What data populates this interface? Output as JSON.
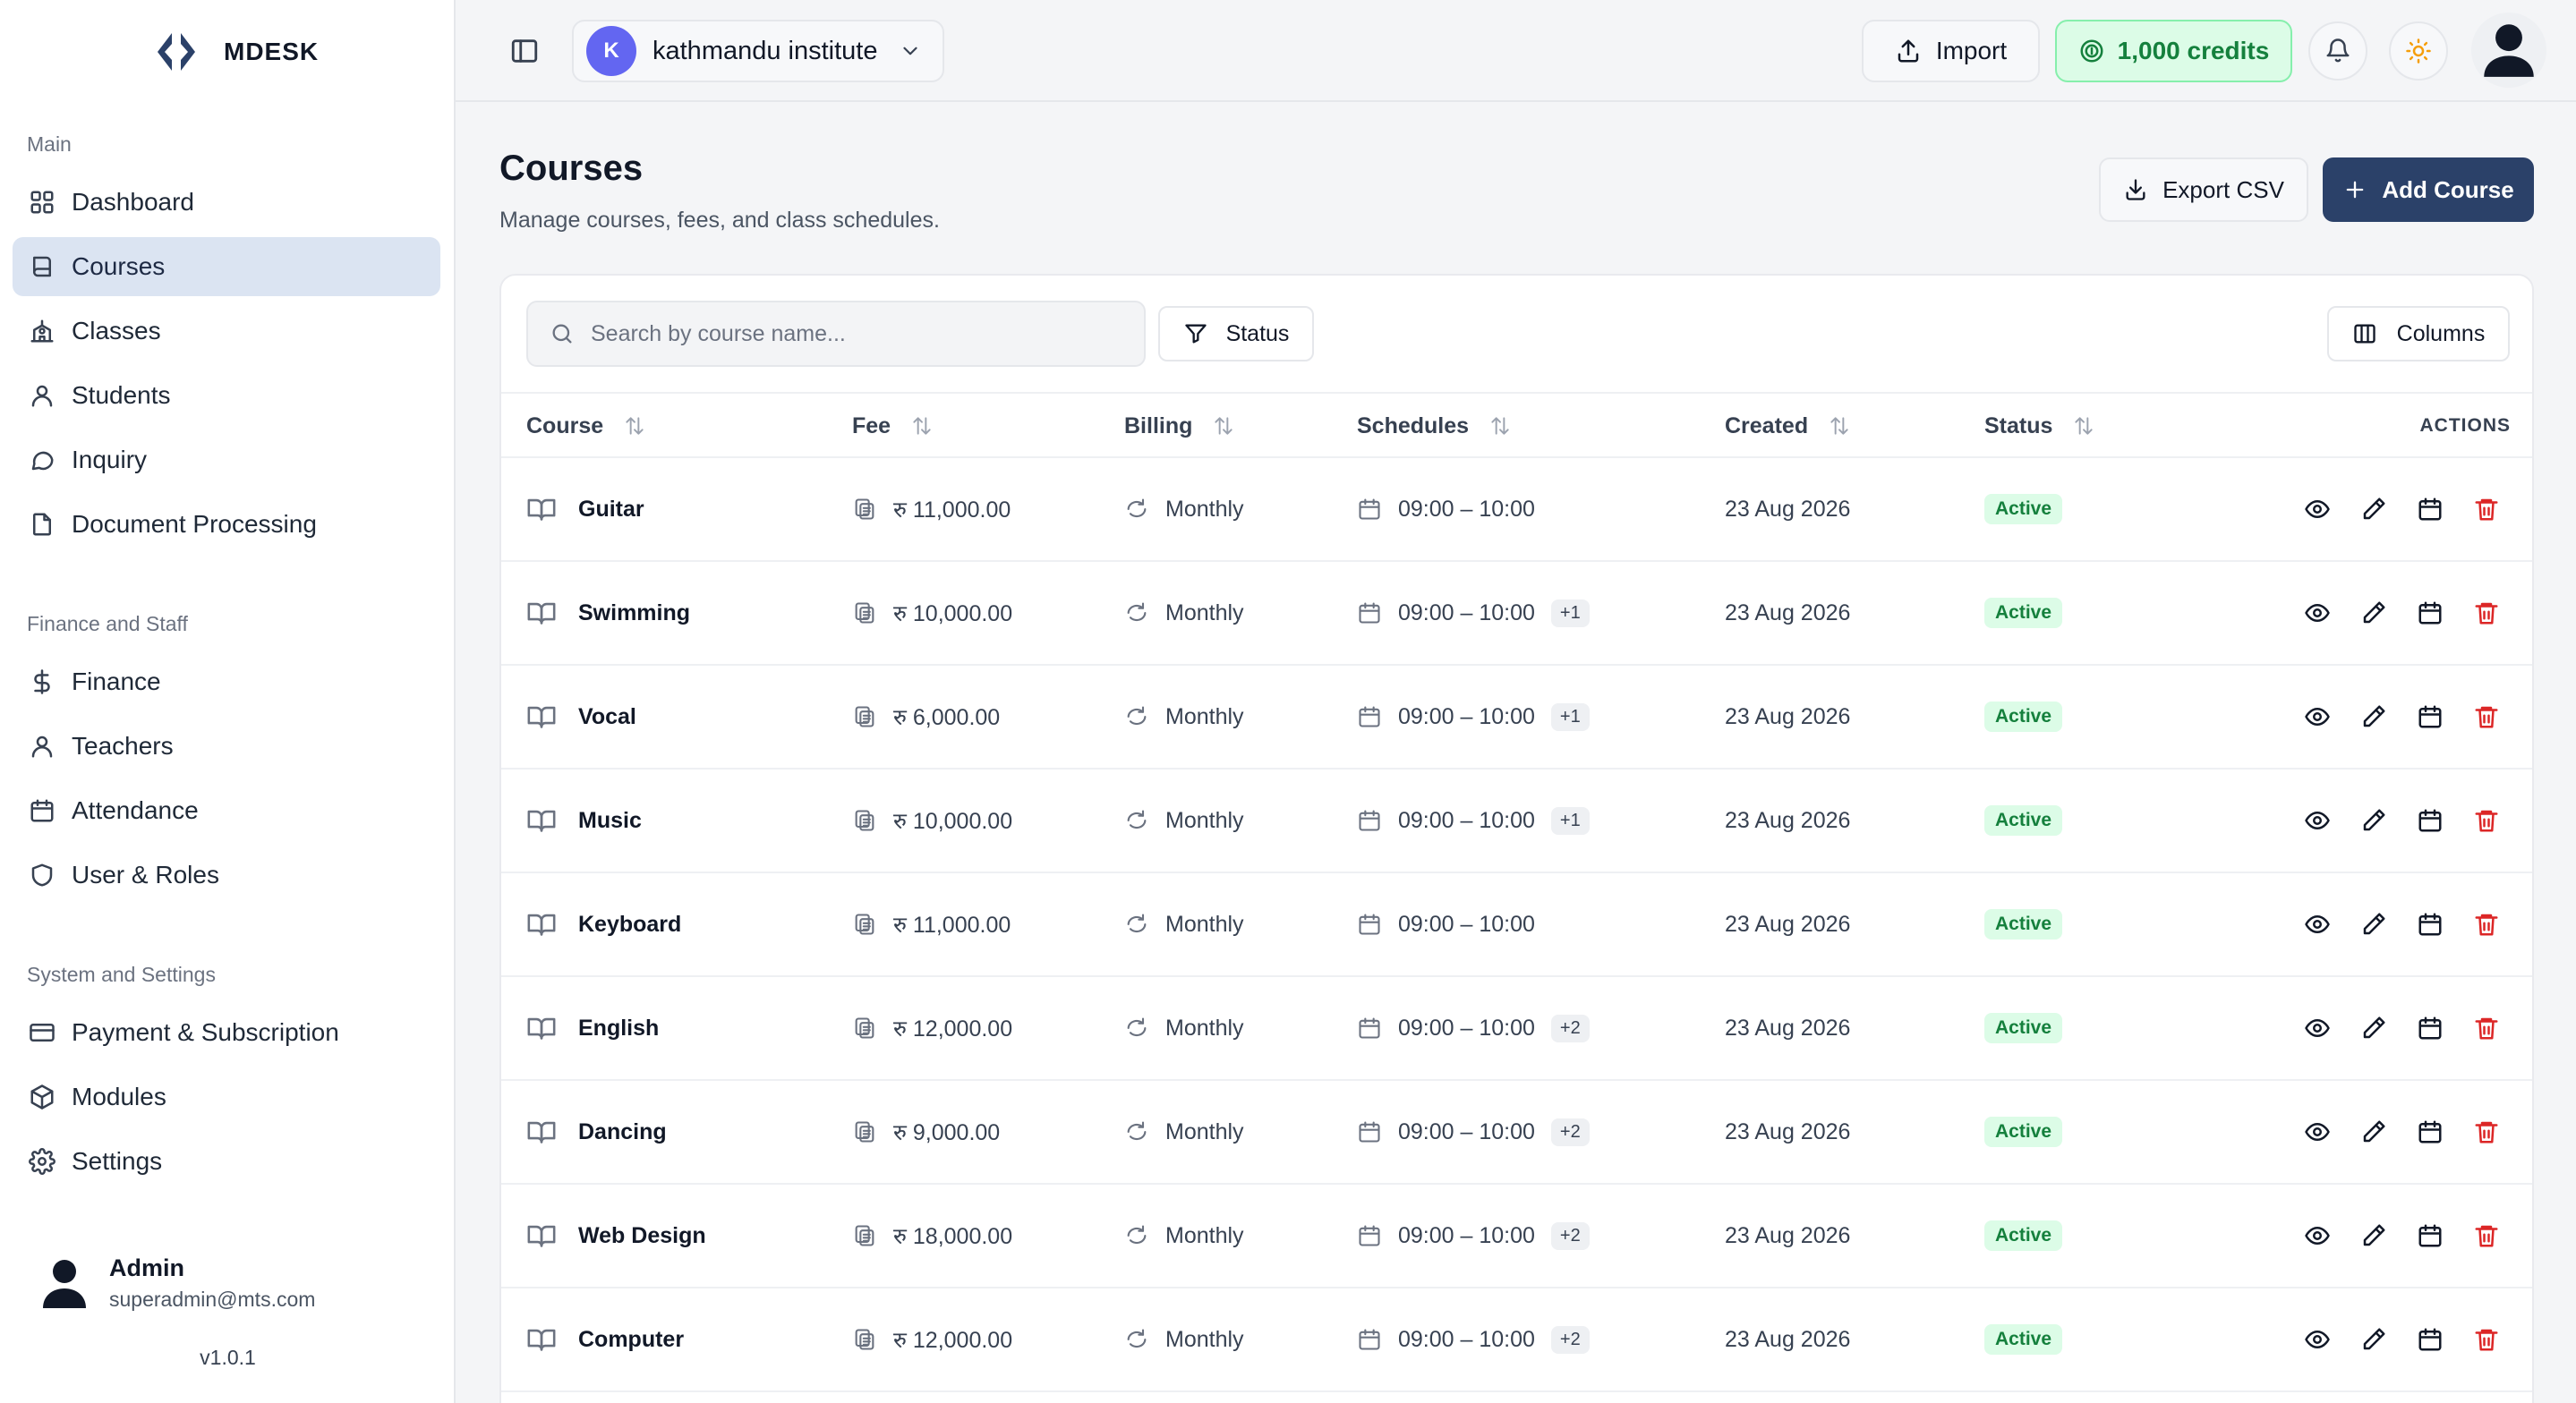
{
  "brand": {
    "name": "MDESK"
  },
  "sidebar": {
    "sections": [
      {
        "title": "Main",
        "items": [
          {
            "label": "Dashboard",
            "icon": "grid-icon"
          },
          {
            "label": "Courses",
            "icon": "book-icon",
            "active": true
          },
          {
            "label": "Classes",
            "icon": "school-icon"
          },
          {
            "label": "Students",
            "icon": "user-icon"
          },
          {
            "label": "Inquiry",
            "icon": "message-icon"
          },
          {
            "label": "Document Processing",
            "icon": "file-icon"
          }
        ]
      },
      {
        "title": "Finance and Staff",
        "items": [
          {
            "label": "Finance",
            "icon": "dollar-icon"
          },
          {
            "label": "Teachers",
            "icon": "user-icon"
          },
          {
            "label": "Attendance",
            "icon": "calendar-icon"
          },
          {
            "label": "User & Roles",
            "icon": "shield-icon"
          }
        ]
      },
      {
        "title": "System and Settings",
        "items": [
          {
            "label": "Payment & Subscription",
            "icon": "credit-card-icon"
          },
          {
            "label": "Modules",
            "icon": "package-icon"
          },
          {
            "label": "Settings",
            "icon": "gear-icon"
          }
        ]
      }
    ],
    "user": {
      "name": "Admin",
      "email": "superadmin@mts.com"
    },
    "version": "v1.0.1"
  },
  "topbar": {
    "org": {
      "initial": "K",
      "name": "kathmandu institute"
    },
    "import_label": "Import",
    "credits_label": "1,000 credits"
  },
  "page": {
    "title": "Courses",
    "subtitle": "Manage courses, fees, and class schedules.",
    "export_label": "Export CSV",
    "add_label": "Add Course"
  },
  "toolbar": {
    "search_placeholder": "Search by course name...",
    "status_label": "Status",
    "columns_label": "Columns"
  },
  "table": {
    "columns": {
      "course": "Course",
      "fee": "Fee",
      "billing": "Billing",
      "schedules": "Schedules",
      "created": "Created",
      "status": "Status",
      "actions": "ACTIONS"
    },
    "rows": [
      {
        "course": "Guitar",
        "fee": "रु 11,000.00",
        "billing": "Monthly",
        "schedule": "09:00 – 10:00",
        "extra": "",
        "created": "23 Aug 2026",
        "status": "Active"
      },
      {
        "course": "Swimming",
        "fee": "रु 10,000.00",
        "billing": "Monthly",
        "schedule": "09:00 – 10:00",
        "extra": "+1",
        "created": "23 Aug 2026",
        "status": "Active"
      },
      {
        "course": "Vocal",
        "fee": "रु 6,000.00",
        "billing": "Monthly",
        "schedule": "09:00 – 10:00",
        "extra": "+1",
        "created": "23 Aug 2026",
        "status": "Active"
      },
      {
        "course": "Music",
        "fee": "रु 10,000.00",
        "billing": "Monthly",
        "schedule": "09:00 – 10:00",
        "extra": "+1",
        "created": "23 Aug 2026",
        "status": "Active"
      },
      {
        "course": "Keyboard",
        "fee": "रु 11,000.00",
        "billing": "Monthly",
        "schedule": "09:00 – 10:00",
        "extra": "",
        "created": "23 Aug 2026",
        "status": "Active"
      },
      {
        "course": "English",
        "fee": "रु 12,000.00",
        "billing": "Monthly",
        "schedule": "09:00 – 10:00",
        "extra": "+2",
        "created": "23 Aug 2026",
        "status": "Active"
      },
      {
        "course": "Dancing",
        "fee": "रु 9,000.00",
        "billing": "Monthly",
        "schedule": "09:00 – 10:00",
        "extra": "+2",
        "created": "23 Aug 2026",
        "status": "Active"
      },
      {
        "course": "Web Design",
        "fee": "रु 18,000.00",
        "billing": "Monthly",
        "schedule": "09:00 – 10:00",
        "extra": "+2",
        "created": "23 Aug 2026",
        "status": "Active"
      },
      {
        "course": "Computer",
        "fee": "रु 12,000.00",
        "billing": "Monthly",
        "schedule": "09:00 – 10:00",
        "extra": "+2",
        "created": "23 Aug 2026",
        "status": "Active"
      }
    ]
  },
  "colors": {
    "accent": "#2b4169",
    "active_nav": "#dbe4f2",
    "success": "#15803d",
    "danger": "#dc2626",
    "org_avatar": "#6366f1"
  }
}
